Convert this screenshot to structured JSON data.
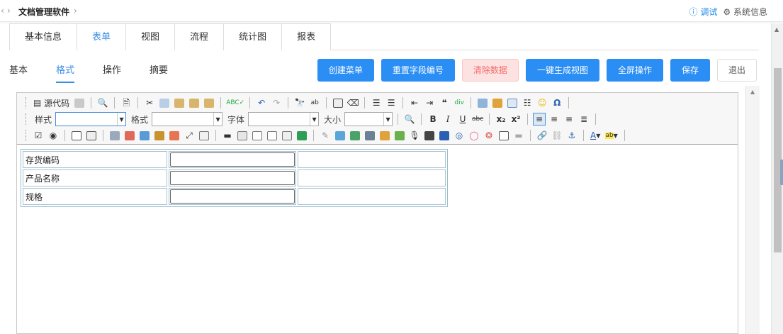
{
  "topbar": {
    "app_title": "文档管理软件",
    "debug_label": "调试",
    "sysinfo_label": "系统信息"
  },
  "tabs": [
    {
      "label": "基本信息",
      "active": false
    },
    {
      "label": "表单",
      "active": true
    },
    {
      "label": "视图",
      "active": false
    },
    {
      "label": "流程",
      "active": false
    },
    {
      "label": "统计图",
      "active": false
    },
    {
      "label": "报表",
      "active": false
    }
  ],
  "subtabs": [
    {
      "label": "基本",
      "active": false
    },
    {
      "label": "格式",
      "active": true
    },
    {
      "label": "操作",
      "active": false
    },
    {
      "label": "摘要",
      "active": false
    }
  ],
  "actions": {
    "create_menu": "创建菜单",
    "reset_field_no": "重置字段编号",
    "clear_data": "清除数据",
    "gen_view": "一键生成视图",
    "fullscreen": "全屏操作",
    "save": "保存",
    "exit": "退出"
  },
  "toolbar": {
    "source": "源代码",
    "style_label": "样式",
    "format_label": "格式",
    "font_label": "字体",
    "size_label": "大小",
    "style_value": "",
    "format_value": "",
    "font_value": "",
    "size_value": ""
  },
  "form": {
    "rows": [
      {
        "label": "存货编码",
        "value": ""
      },
      {
        "label": "产品名称",
        "value": ""
      },
      {
        "label": "规格",
        "value": ""
      }
    ]
  },
  "colors": {
    "primary": "#2a8ef5",
    "accent_text": "#3a8ee6",
    "danger_bg": "#fde2e2",
    "danger_text": "#f56c6c"
  }
}
